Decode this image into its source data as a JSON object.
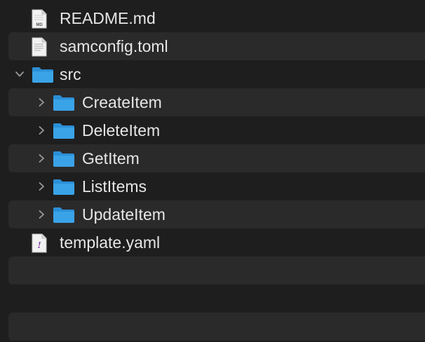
{
  "tree": {
    "items": [
      {
        "label": "README.md",
        "icon": "markdown-file-icon",
        "badge": "MD",
        "expanded": null
      },
      {
        "label": "samconfig.toml",
        "icon": "text-file-icon",
        "expanded": null
      },
      {
        "label": "src",
        "icon": "folder-icon",
        "expanded": true
      },
      {
        "label": "CreateItem",
        "icon": "folder-icon",
        "expanded": false
      },
      {
        "label": "DeleteItem",
        "icon": "folder-icon",
        "expanded": false
      },
      {
        "label": "GetItem",
        "icon": "folder-icon",
        "expanded": false
      },
      {
        "label": "ListItems",
        "icon": "folder-icon",
        "expanded": false
      },
      {
        "label": "UpdateItem",
        "icon": "folder-icon",
        "expanded": false
      },
      {
        "label": "template.yaml",
        "icon": "yaml-file-icon",
        "badge": "!",
        "expanded": null
      }
    ]
  },
  "colors": {
    "background": "#1e1e1e",
    "stripe": "#2a2a2b",
    "text": "#e6e6e6",
    "folder": "#3aa3e8",
    "disclosure": "#9a9a9a"
  }
}
